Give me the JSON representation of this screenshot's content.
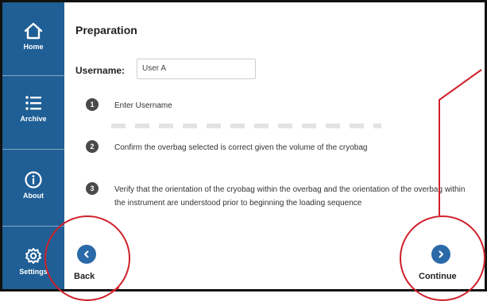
{
  "sidebar": {
    "items": [
      {
        "label": "Home",
        "icon": "home-icon"
      },
      {
        "label": "Archive",
        "icon": "list-icon"
      },
      {
        "label": "About",
        "icon": "info-icon"
      },
      {
        "label": "Settings",
        "icon": "gear-icon"
      }
    ]
  },
  "page": {
    "title": "Preparation",
    "username_label": "Username:",
    "username_value": "User A",
    "steps": [
      {
        "number": "1",
        "text": "Enter Username"
      },
      {
        "number": "2",
        "text": "Confirm the overbag selected is correct given the volume of the cryobag"
      },
      {
        "number": "3",
        "text": "Verify that the orientation of the cryobag within the overbag and the orientation of the overbag within the instrument are understood prior to beginning the loading sequence"
      }
    ]
  },
  "footer": {
    "back_label": "Back",
    "continue_label": "Continue"
  },
  "colors": {
    "sidebar": "#1f5f95",
    "button": "#2a6aa8",
    "callout": "#d0202a"
  }
}
